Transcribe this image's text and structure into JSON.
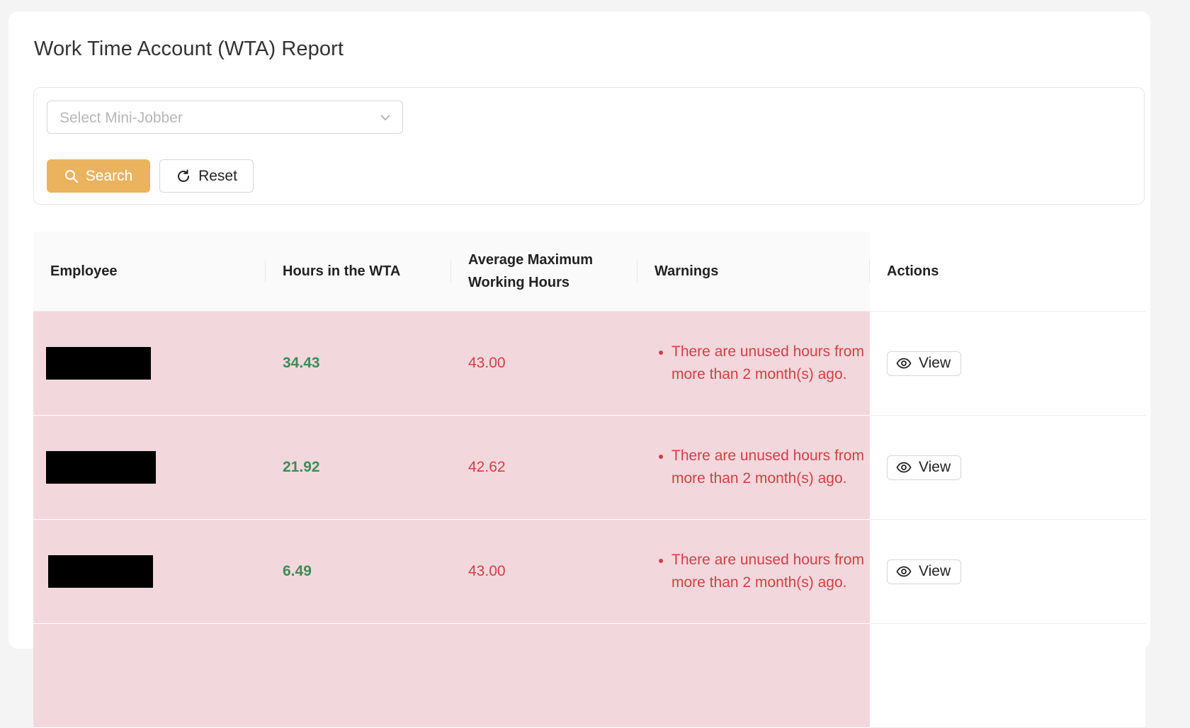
{
  "page": {
    "title": "Work Time Account (WTA) Report"
  },
  "filters": {
    "select_placeholder": "Select Mini-Jobber",
    "search_label": "Search",
    "reset_label": "Reset"
  },
  "table": {
    "headers": {
      "employee": "Employee",
      "hours": "Hours in the WTA",
      "avg_max_line1": "Average Maximum",
      "avg_max_line2": "Working Hours",
      "warnings": "Warnings",
      "actions": "Actions"
    },
    "rows": [
      {
        "employee": "[redacted]",
        "hours": "34.43",
        "avg_max": "43.00",
        "warning": "There are unused hours from more than 2 month(s) ago.",
        "action": "View"
      },
      {
        "employee": "[redacted]",
        "hours": "21.92",
        "avg_max": "42.62",
        "warning": "There are unused hours from more than 2 month(s) ago.",
        "action": "View"
      },
      {
        "employee": "[redacted]",
        "hours": "6.49",
        "avg_max": "43.00",
        "warning": "There are unused hours from more than 2 month(s) ago.",
        "action": "View"
      }
    ]
  },
  "icons": {
    "search": "search-icon",
    "reset": "reload-icon",
    "view": "eye-icon",
    "chevron": "chevron-down-icon"
  },
  "colors": {
    "primary": "#eab35e",
    "warning_row": "#f2d8dc",
    "hours_green": "#3f8a58",
    "warning_red": "#cf4146"
  }
}
